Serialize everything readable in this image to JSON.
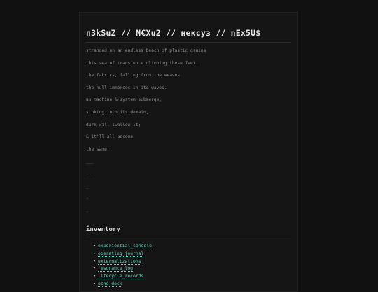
{
  "header": {
    "title": "n3kSuZ // N€Xu2 // нексуз // nEx5U$"
  },
  "poem": {
    "lines": [
      "stranded on an endless beach of plastic grains",
      "this sea of transience climbing these feet.",
      "the fabrics, falling from the weaves",
      "the hull immerses in its waves.",
      "as machine & system submerge,",
      "sinking into its domain,",
      "dark will swallow it;",
      "& it'll all become",
      "the same.",
      "___",
      "--",
      "_",
      "-",
      "."
    ]
  },
  "inventory": {
    "title": "inventory",
    "bullet": "•",
    "items": [
      "experiential_console",
      "operating_journal",
      "externalizations",
      "resonance_log",
      "lifecycle_records",
      "echo_dock"
    ]
  }
}
